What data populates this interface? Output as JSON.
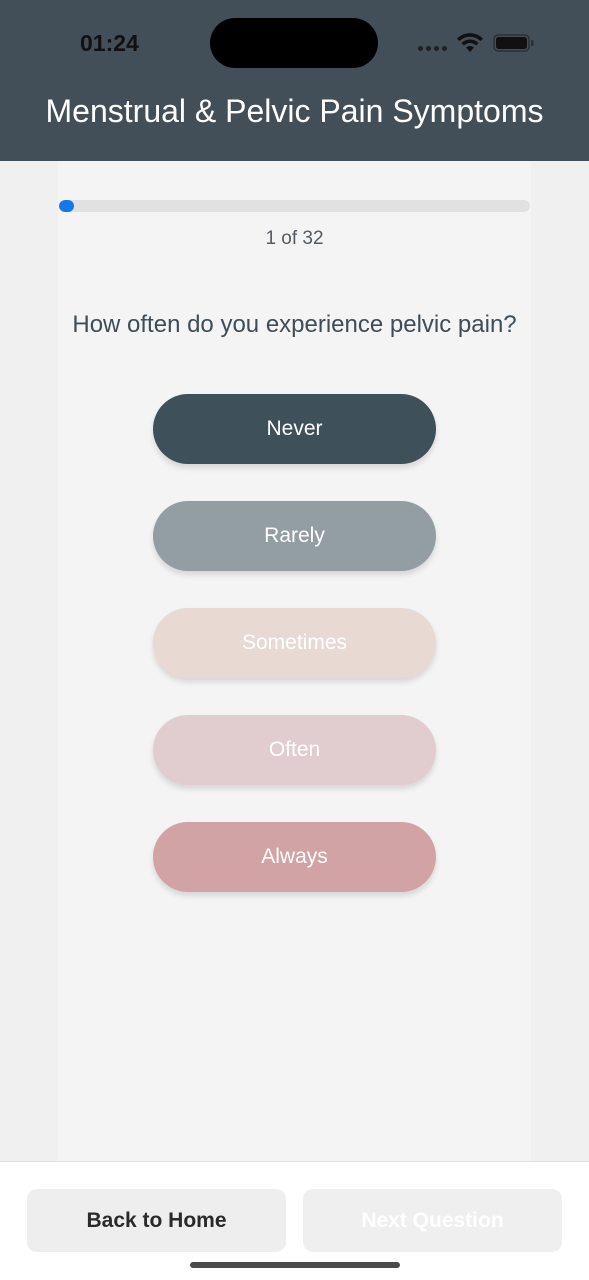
{
  "status_bar": {
    "time": "01:24"
  },
  "header": {
    "title": "Menstrual & Pelvic Pain Symptoms"
  },
  "progress": {
    "current": 1,
    "total": 32,
    "label": "1 of 32",
    "fraction": 0.031,
    "color": "#1478e8"
  },
  "question": {
    "text": "How often do you experience pelvic pain?"
  },
  "options": [
    {
      "label": "Never",
      "color": "#3e505a"
    },
    {
      "label": "Rarely",
      "color": "#939ea3"
    },
    {
      "label": "Sometimes",
      "color": "#e8dad3"
    },
    {
      "label": "Often",
      "color": "#e1cdcf"
    },
    {
      "label": "Always",
      "color": "#d1a3a4"
    }
  ],
  "footer": {
    "back_label": "Back to Home",
    "next_label": "Next Question"
  },
  "icons": [
    "wifi-icon",
    "battery-icon",
    "signal-icon"
  ],
  "colors": {
    "header_bg": "#434f58",
    "accent": "#1478e8"
  }
}
